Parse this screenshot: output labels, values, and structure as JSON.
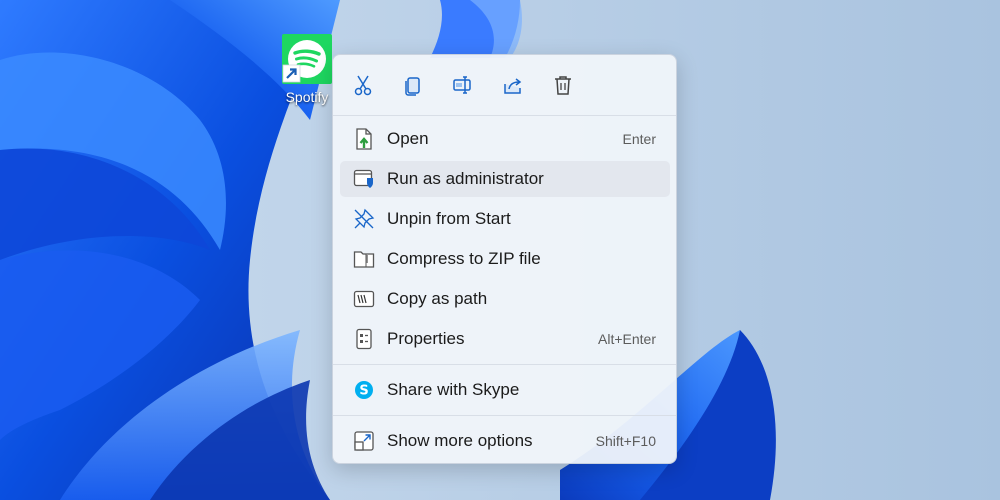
{
  "desktop": {
    "wallpaper": "Windows 11 bloom",
    "icons": [
      {
        "label": "Spotify",
        "icon": "spotify-icon",
        "shortcut_overlay": true
      }
    ]
  },
  "context_menu": {
    "toolbar": [
      {
        "name": "cut",
        "icon": "scissors-icon"
      },
      {
        "name": "copy",
        "icon": "copy-icon"
      },
      {
        "name": "rename",
        "icon": "rename-icon"
      },
      {
        "name": "share",
        "icon": "share-icon"
      },
      {
        "name": "delete",
        "icon": "trash-icon"
      }
    ],
    "items": [
      {
        "label": "Open",
        "shortcut": "Enter",
        "icon": "open-icon"
      },
      {
        "label": "Run as administrator",
        "shortcut": "",
        "icon": "admin-shield-icon"
      },
      {
        "label": "Unpin from Start",
        "shortcut": "",
        "icon": "unpin-icon"
      },
      {
        "label": "Compress to ZIP file",
        "shortcut": "",
        "icon": "zip-folder-icon"
      },
      {
        "label": "Copy as path",
        "shortcut": "",
        "icon": "copy-path-icon"
      },
      {
        "label": "Properties",
        "shortcut": "Alt+Enter",
        "icon": "properties-icon"
      },
      {
        "label": "Share with Skype",
        "shortcut": "",
        "icon": "skype-icon"
      },
      {
        "label": "Show more options",
        "shortcut": "Shift+F10",
        "icon": "more-options-icon"
      }
    ]
  },
  "colors": {
    "accent": "#0067c0",
    "spotify": "#1ed760",
    "skype": "#00aff0",
    "menu_bg": "#f0f4fa"
  }
}
